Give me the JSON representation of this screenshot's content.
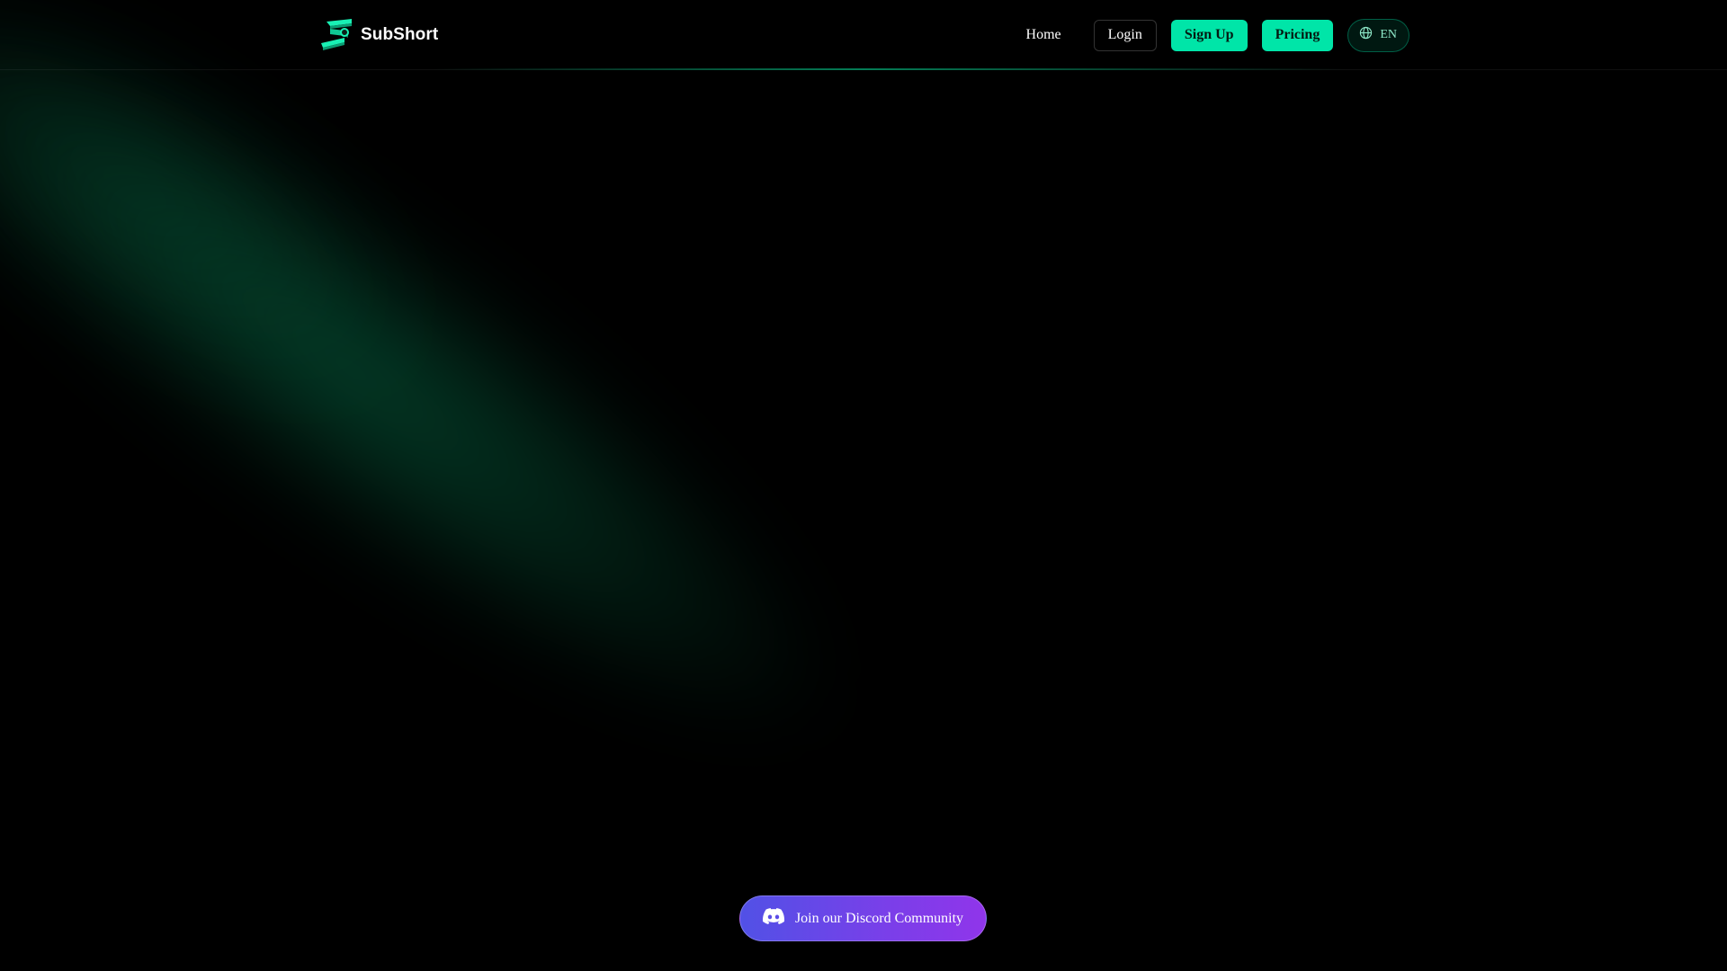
{
  "brand": {
    "name": "SubShort",
    "accent_color": "#00e5a8"
  },
  "nav": {
    "home_label": "Home",
    "login_label": "Login",
    "signup_label": "Sign Up",
    "pricing_label": "Pricing",
    "language": {
      "icon": "globe-icon",
      "label": "EN"
    }
  },
  "community": {
    "discord_label": "Join our Discord Community",
    "icon": "discord-icon",
    "colors": [
      "#5151e6",
      "#9035ea"
    ]
  }
}
